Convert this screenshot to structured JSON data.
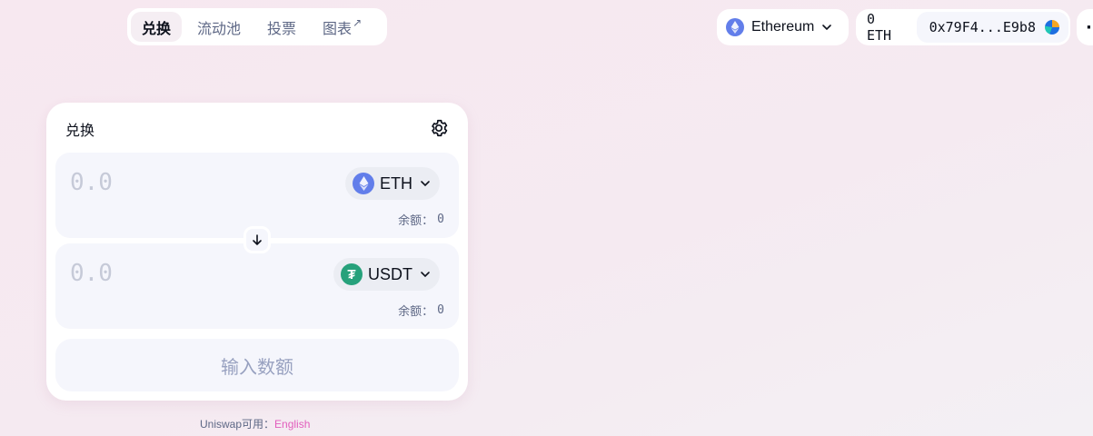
{
  "nav": {
    "tabs": [
      {
        "label": "兑换",
        "active": true
      },
      {
        "label": "流动池",
        "active": false
      },
      {
        "label": "投票",
        "active": false
      },
      {
        "label": "图表",
        "active": false,
        "external": true
      }
    ]
  },
  "network": {
    "label": "Ethereum",
    "icon": "ethereum-icon"
  },
  "account": {
    "balance": "0 ETH",
    "address": "0x79F4...E9b8"
  },
  "more": {
    "label": "··"
  },
  "swap": {
    "title": "兑换",
    "input": {
      "placeholder": "0.0",
      "token": "ETH",
      "balance_label": "余额：",
      "balance_value": "0"
    },
    "output": {
      "placeholder": "0.0",
      "token": "USDT",
      "balance_label": "余额：",
      "balance_value": "0"
    },
    "submit_label": "输入数额"
  },
  "footer": {
    "text": "Uniswap可用：",
    "link": "English"
  },
  "colors": {
    "accent_pink": "#e25ebd",
    "eth_blue": "#627eea",
    "usdt_green": "#26a17b"
  }
}
